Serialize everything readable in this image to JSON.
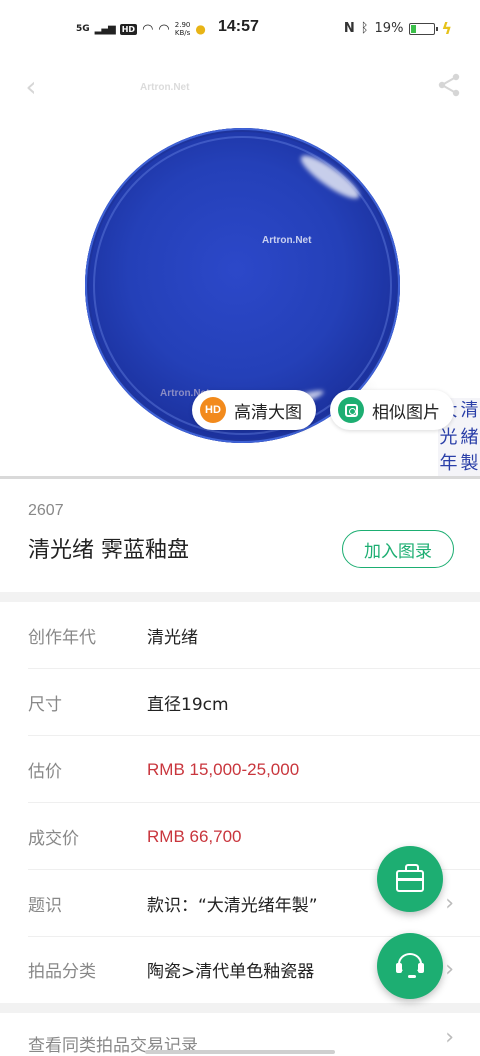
{
  "status_bar": {
    "network": "5G",
    "hd": "HD",
    "speed_value": "2.90",
    "speed_unit": "KB/s",
    "time": "14:57",
    "battery": "19%"
  },
  "image": {
    "watermark": "Artron.Net",
    "mark_text": [
      "大",
      "清",
      "光",
      "緒",
      "年",
      "製"
    ],
    "hd_button": {
      "icon_text": "HD",
      "label": "高清大图"
    },
    "similar_button": {
      "label": "相似图片"
    }
  },
  "lot": {
    "number": "2607",
    "title": "清光绪 霁蓝釉盘",
    "catalog_button": "加入图录"
  },
  "details": [
    {
      "key": "创作年代",
      "value": "清光绪",
      "highlight": false,
      "chevron": false
    },
    {
      "key": "尺寸",
      "value": "直径19cm",
      "highlight": false,
      "chevron": false
    },
    {
      "key": "估价",
      "value": "RMB  15,000-25,000",
      "highlight": true,
      "chevron": false
    },
    {
      "key": "成交价",
      "value": "RMB 66,700",
      "highlight": true,
      "chevron": false
    },
    {
      "key": "题识",
      "value": "款识：“大清光绪年製”",
      "highlight": false,
      "chevron": true
    },
    {
      "key": "拍品分类",
      "value": "陶瓷>清代单色釉瓷器",
      "highlight": false,
      "chevron": true
    }
  ],
  "more_link": "查看同类拍品交易记录",
  "colors": {
    "accent": "#1dae72",
    "price": "#c9363d",
    "hd_badge": "#f28a1c",
    "plate_blue": "#2440b8"
  },
  "icons": {
    "back": "back-arrow-icon",
    "share": "share-icon",
    "bag": "bag-icon",
    "service": "headset-icon"
  }
}
